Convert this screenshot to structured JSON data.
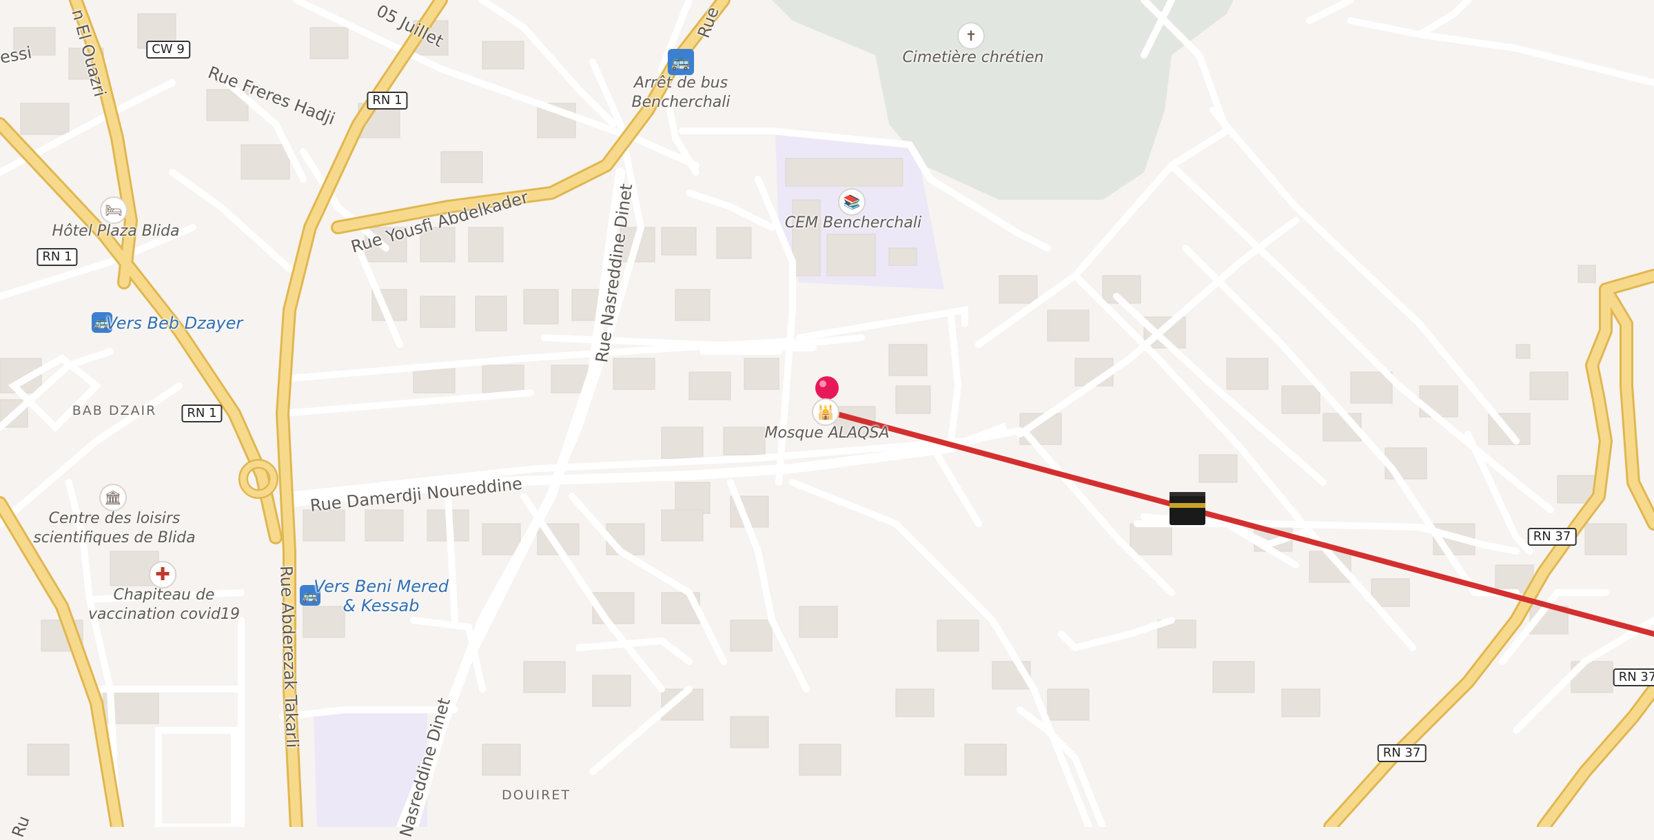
{
  "streets": {
    "freres_hadji": "Rue Freres Hadji",
    "yousfi": "Rue Yousfi Abdelkader",
    "nasreddine_top": "Rue Nasreddine Dinet",
    "nasreddine_bottom": "Nasreddine Dinet",
    "damerdji": "Rue Damerdji Noureddine",
    "takarli": "Rue Abderezak Takarli",
    "juillet": "05 Juillet",
    "ouazri": "n El Ouazri",
    "essi": "essi",
    "ru": "Ru",
    "rue_top": "Rue"
  },
  "shields": {
    "cw9": "CW 9",
    "rn1_a": "RN 1",
    "rn1_b": "RN 1",
    "rn1_c": "RN 1",
    "rn37_a": "RN 37",
    "rn37_b": "RN 37",
    "rn37_c": "RN 37"
  },
  "places": {
    "cimetiere": "Cimetière chrétien",
    "arret": "Arrêt de bus\nBencherchali",
    "cem": "CEM Bencherchali",
    "hotel": "Hôtel Plaza Blida",
    "beb_dzayer": "Vers Beb Dzayer",
    "bab_dzair": "BAB DZAIR",
    "mosque": "Mosque ALAQSA",
    "centre_loisirs": "Centre des loisirs\nscientifiques de Blida",
    "chapiteau": "Chapiteau de\nvaccination covid19",
    "beni_mered": "Vers Beni Mered\n& Kessab",
    "douiret": "DOUIRET"
  },
  "icons": {
    "pin": "map-pin-icon",
    "kaaba": "kaaba-icon",
    "bus": "bus-icon",
    "hotel": "bed-icon",
    "school": "school-icon",
    "cemetery": "cemetery-icon",
    "mosque": "mosque-icon",
    "museum": "museum-icon",
    "medical": "medical-cross-icon"
  },
  "colors": {
    "land": "#f6f3f0",
    "building": "#e7e1dc",
    "road": "#ffffff",
    "major_road": "#f7d98b",
    "major_road_casing": "#e0b64f",
    "park": "#e2e6e0",
    "school_area": "#ece8f7",
    "qibla_line": "#d32f2f",
    "pin": "#e8195a",
    "bus": "#3b7fd0"
  }
}
